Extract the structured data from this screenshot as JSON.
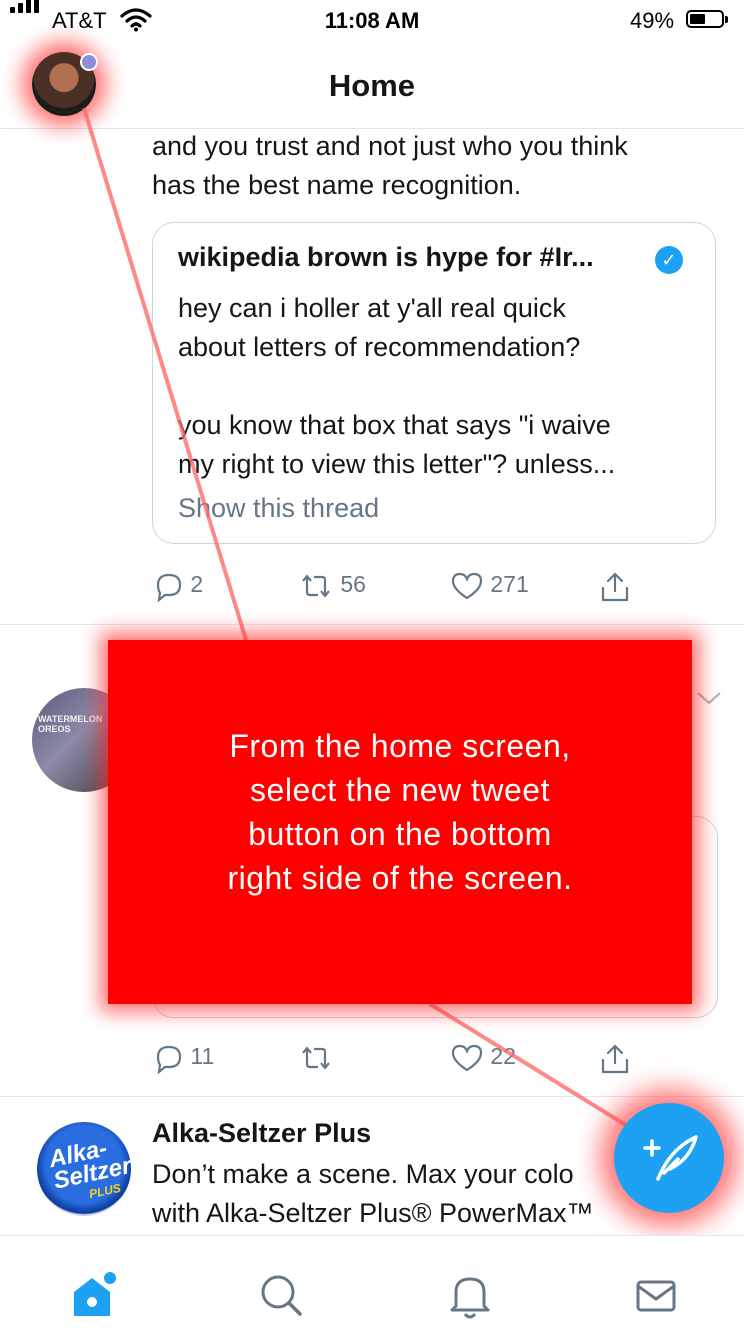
{
  "status_bar": {
    "carrier": "AT&T",
    "time": "11:08 AM",
    "battery": "49%"
  },
  "header": {
    "title": "Home"
  },
  "tweet1": {
    "text_lines": [
      "and you trust and not just who you think",
      "has the best name recognition."
    ],
    "quote": {
      "name": "wikipedia brown is hype for #Ir...",
      "lines": [
        "hey can i holler at y'all real quick",
        "about letters of recommendation?",
        "",
        "you know that box that says \"i waive",
        "my right to view this letter\"? unless..."
      ],
      "show_thread": "Show this thread"
    },
    "actions": {
      "replies": "2",
      "retweets": "56",
      "likes": "271"
    }
  },
  "tweet2": {
    "avatar_sign": "WATERMELON OREOS",
    "actions": {
      "replies": "11",
      "retweets": "",
      "likes": "22"
    }
  },
  "promoted": {
    "name": "Alka-Seltzer Plus",
    "lines": [
      "Don’t make a scene. Max your colo",
      "with Alka-Seltzer Plus® PowerMax™"
    ],
    "logo_main": "Alka-Seltzer",
    "logo_sub": "PLUS"
  },
  "annotation": {
    "lines": [
      "From the home screen,",
      "select the new tweet",
      "button on the bottom",
      "right side of the screen."
    ]
  },
  "tabs": [
    "home-icon",
    "search-icon",
    "notifications-icon",
    "messages-icon"
  ],
  "colors": {
    "accent": "#1da1f2",
    "callout": "#ff0000",
    "muted": "#657786",
    "border": "#e1e8ed"
  }
}
